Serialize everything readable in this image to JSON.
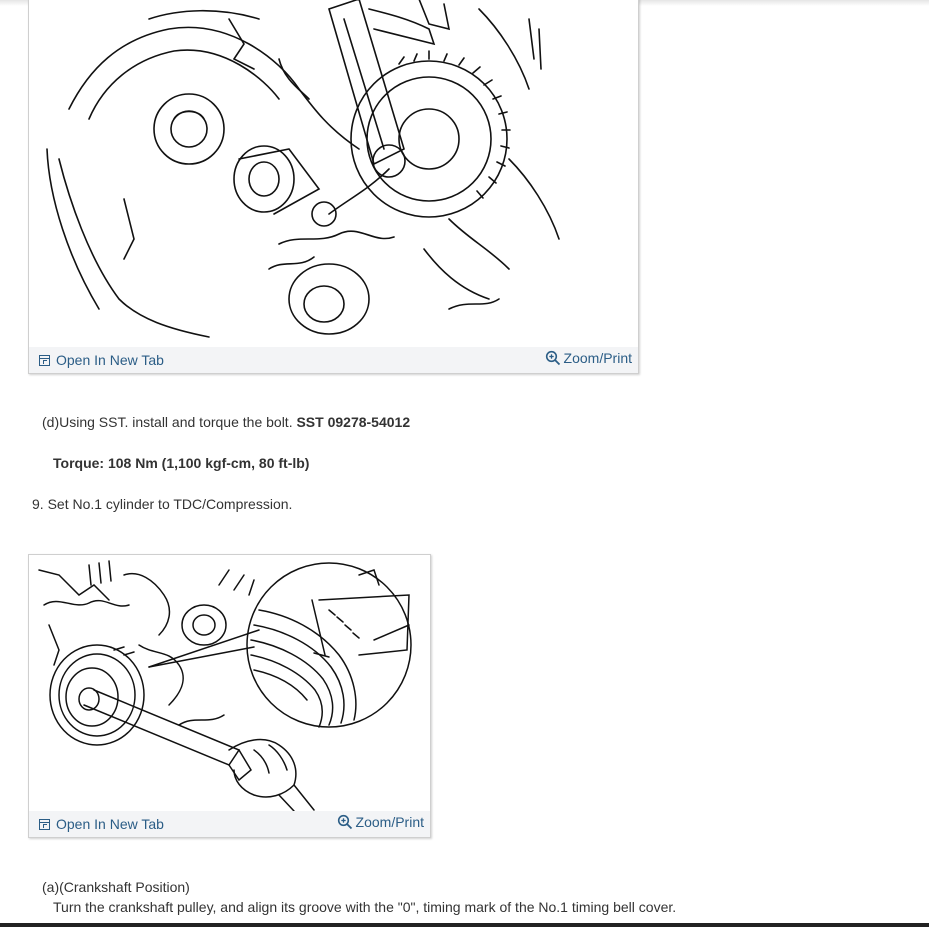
{
  "figure1": {
    "open_tab_label": "Open In New Tab",
    "zoom_label": "Zoom/Print"
  },
  "step_d": {
    "prefix": "(d)Using SST. install and torque the bolt.",
    "sst_code": "SST 09278-54012",
    "torque_label": "Torque: 108 Nm (1,100 kgf-cm, 80 ft-lb)"
  },
  "step_9": {
    "text": "9. Set No.1 cylinder to TDC/Compression."
  },
  "figure2": {
    "open_tab_label": "Open In New Tab",
    "zoom_label": "Zoom/Print"
  },
  "step_a": {
    "heading": "(a)(Crankshaft Position)",
    "body": "Turn the crankshaft pulley, and align its groove with the \"0\", timing mark of the No.1 timing bell cover."
  },
  "colors": {
    "link": "#2b5d86",
    "text": "#333333",
    "bar": "#f3f4f6"
  }
}
